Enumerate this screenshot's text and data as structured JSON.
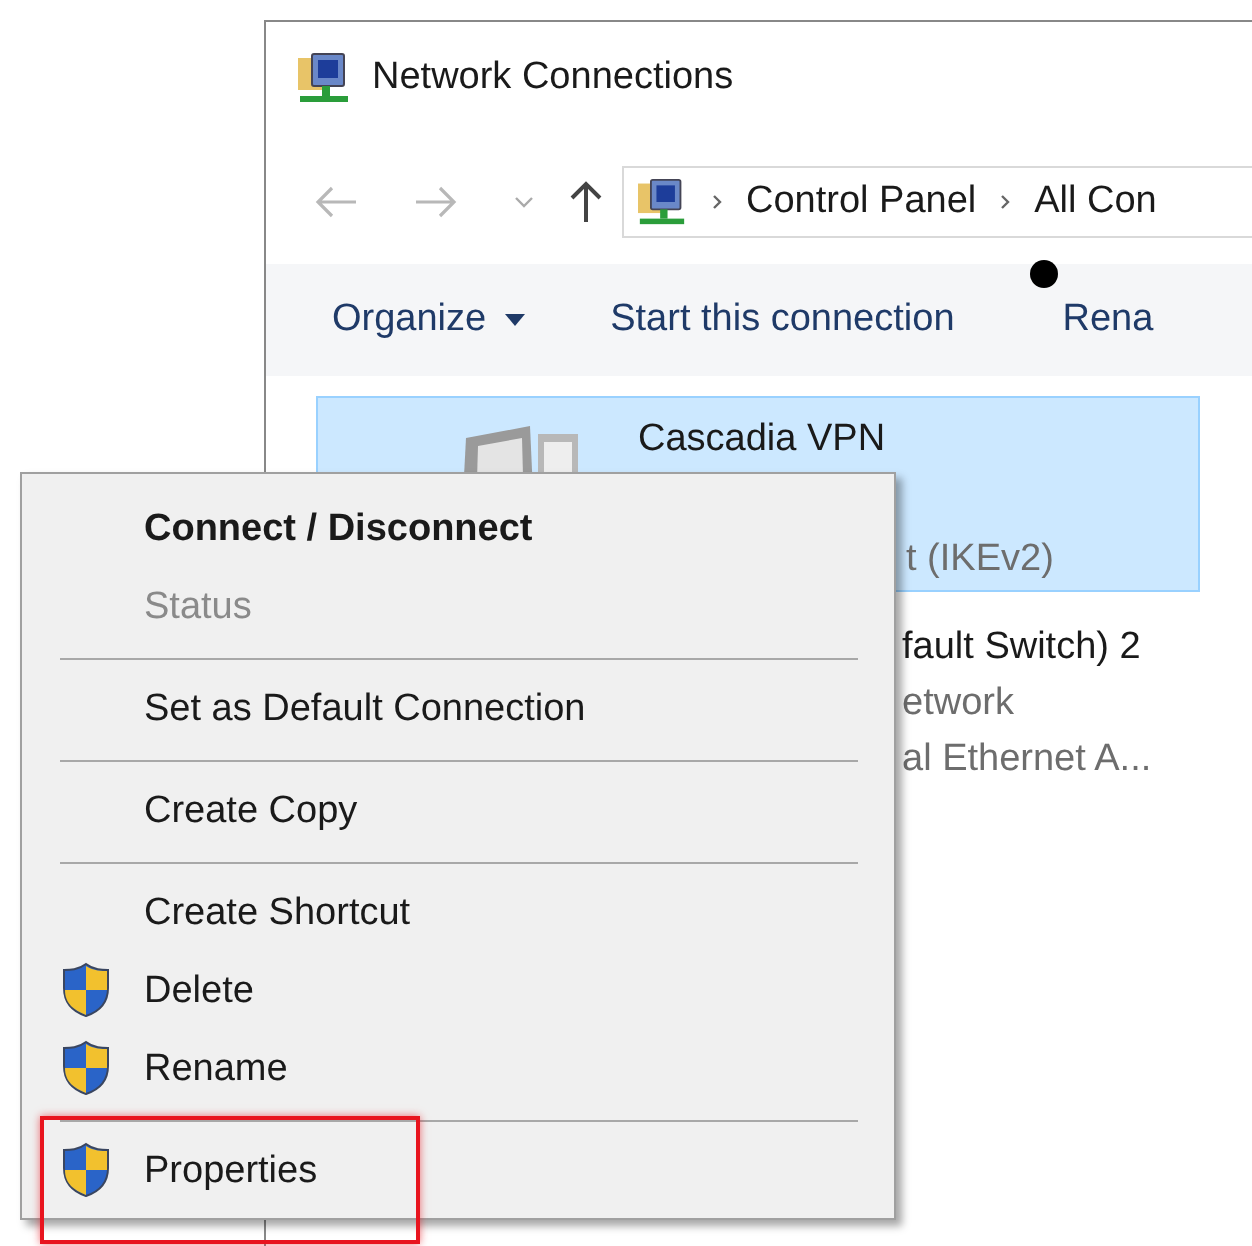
{
  "window": {
    "title": "Network Connections"
  },
  "address_bar": {
    "crumbs": [
      "Control Panel",
      "All Con"
    ]
  },
  "toolbar": {
    "items": [
      {
        "label": "Organize",
        "dropdown": true
      },
      {
        "label": "Start this connection",
        "dropdown": false
      },
      {
        "label": "Rena",
        "dropdown": false
      }
    ]
  },
  "connections": [
    {
      "lines": [
        "Cascadia VPN",
        "t (IKEv2)"
      ],
      "selected": true
    },
    {
      "lines": [
        "fault Switch) 2",
        "etwork",
        "al Ethernet A..."
      ],
      "selected": false
    }
  ],
  "context_menu": {
    "groups": [
      [
        {
          "label": "Connect / Disconnect",
          "kind": "default",
          "shield": false,
          "highlighted": false
        },
        {
          "label": "Status",
          "kind": "disabled",
          "shield": false,
          "highlighted": false
        }
      ],
      [
        {
          "label": "Set as Default Connection",
          "kind": "normal",
          "shield": false,
          "highlighted": false
        }
      ],
      [
        {
          "label": "Create Copy",
          "kind": "normal",
          "shield": false,
          "highlighted": false
        }
      ],
      [
        {
          "label": "Create Shortcut",
          "kind": "normal",
          "shield": false,
          "highlighted": false
        },
        {
          "label": "Delete",
          "kind": "normal",
          "shield": true,
          "highlighted": false
        },
        {
          "label": "Rename",
          "kind": "normal",
          "shield": true,
          "highlighted": false
        }
      ],
      [
        {
          "label": "Properties",
          "kind": "normal",
          "shield": true,
          "highlighted": true
        }
      ]
    ]
  }
}
